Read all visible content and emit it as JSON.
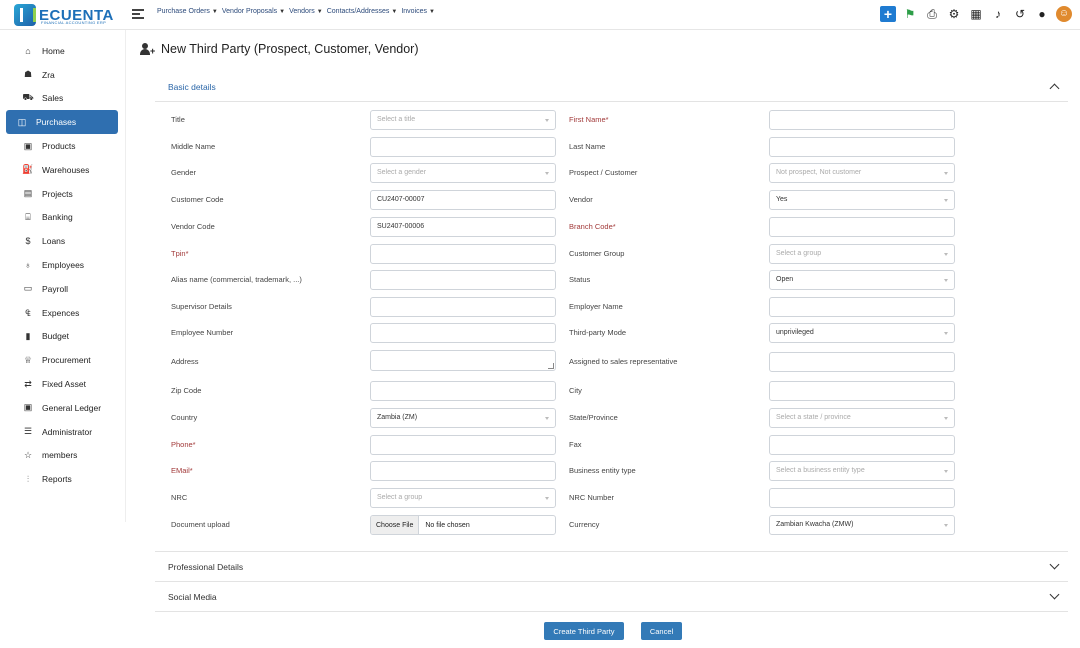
{
  "app": {
    "logo_text": "ECUENTA",
    "logo_sub": "FINANCIAL ACCOUNTING ERP"
  },
  "topnav": {
    "items": [
      {
        "label": "Purchase Orders"
      },
      {
        "label": "Vendor Proposals"
      },
      {
        "label": "Vendors"
      },
      {
        "label": "Contacts/Addresses"
      },
      {
        "label": "Invoices"
      }
    ]
  },
  "topbar_icons": [
    "plus-icon",
    "flags-icon",
    "printer-icon",
    "settings-icon",
    "calendar-icon",
    "bell-icon",
    "history-icon",
    "location-icon",
    "user-avatar-icon"
  ],
  "sidebar": {
    "items": [
      {
        "label": "Home",
        "icon": "home-icon"
      },
      {
        "label": "Zra",
        "icon": "group-icon"
      },
      {
        "label": "Sales",
        "icon": "cart-icon"
      },
      {
        "label": "Purchases",
        "icon": "bag-icon",
        "active": true
      },
      {
        "label": "Products",
        "icon": "box-icon"
      },
      {
        "label": "Warehouses",
        "icon": "truck-icon"
      },
      {
        "label": "Projects",
        "icon": "briefcase-icon"
      },
      {
        "label": "Banking",
        "icon": "bank-icon"
      },
      {
        "label": "Loans",
        "icon": "coin-icon"
      },
      {
        "label": "Employees",
        "icon": "users-icon"
      },
      {
        "label": "Payroll",
        "icon": "payroll-icon"
      },
      {
        "label": "Expences",
        "icon": "expense-icon"
      },
      {
        "label": "Budget",
        "icon": "budget-icon"
      },
      {
        "label": "Procurement",
        "icon": "procurement-icon"
      },
      {
        "label": "Fixed Asset",
        "icon": "asset-icon"
      },
      {
        "label": "General Ledger",
        "icon": "ledger-icon"
      },
      {
        "label": "Administrator",
        "icon": "admin-icon"
      },
      {
        "label": "members",
        "icon": "members-icon"
      },
      {
        "label": "Reports",
        "icon": "chart-icon"
      }
    ]
  },
  "page": {
    "title": "New Third Party (Prospect, Customer, Vendor)"
  },
  "sections": {
    "basic": "Basic details",
    "professional": "Professional Details",
    "social": "Social Media"
  },
  "form": {
    "title_label": "Title",
    "title_placeholder": "Select a title",
    "first_name_label": "First Name*",
    "first_name_value": "",
    "middle_name_label": "Middle Name",
    "middle_name_value": "",
    "last_name_label": "Last Name",
    "last_name_value": "",
    "gender_label": "Gender",
    "gender_placeholder": "Select a gender",
    "prospect_label": "Prospect / Customer",
    "prospect_value": "Not prospect, Not customer",
    "customer_code_label": "Customer Code",
    "customer_code_value": "CU2407-00007",
    "vendor_label": "Vendor",
    "vendor_value": "Yes",
    "vendor_code_label": "Vendor Code",
    "vendor_code_value": "SU2407-00006",
    "branch_code_label": "Branch Code*",
    "branch_code_value": "",
    "tpin_label": "Tpin*",
    "tpin_value": "",
    "customer_group_label": "Customer Group",
    "customer_group_placeholder": "Select a group",
    "alias_label": "Alias name (commercial, trademark, ...)",
    "alias_value": "",
    "status_label": "Status",
    "status_value": "Open",
    "supervisor_label": "Supervisor Details",
    "supervisor_value": "",
    "employer_label": "Employer Name",
    "employer_value": "",
    "employee_number_label": "Employee Number",
    "employee_number_value": "",
    "mode_label": "Third-party Mode",
    "mode_value": "unprivileged",
    "address_label": "Address",
    "address_value": "",
    "sales_rep_label": "Assigned to sales representative",
    "sales_rep_value": "",
    "zip_label": "Zip Code",
    "zip_value": "",
    "city_label": "City",
    "city_value": "",
    "country_label": "Country",
    "country_value": "Zambia (ZM)",
    "state_label": "State/Province",
    "state_placeholder": "Select a state / province",
    "phone_label": "Phone*",
    "phone_value": "",
    "fax_label": "Fax",
    "fax_value": "",
    "email_label": "EMail*",
    "email_value": "",
    "entity_type_label": "Business entity type",
    "entity_type_placeholder": "Select a business entity type",
    "nrc_label": "NRC",
    "nrc_placeholder": "Select a group",
    "nrc_number_label": "NRC Number",
    "nrc_number_value": "",
    "document_label": "Document upload",
    "file_button": "Choose File",
    "file_status": "No file chosen",
    "currency_label": "Currency",
    "currency_value": "Zambian Kwacha (ZMW)"
  },
  "actions": {
    "create": "Create Third Party",
    "cancel": "Cancel"
  }
}
